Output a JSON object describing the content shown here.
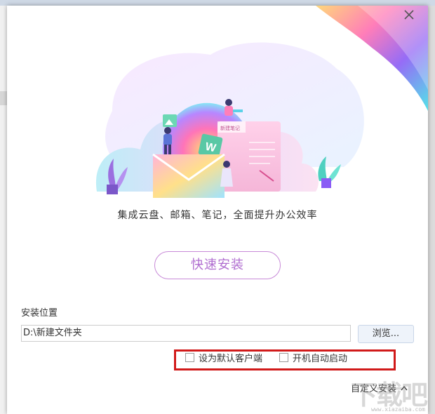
{
  "installer": {
    "tagline": "集成云盘、邮箱、笔记，全面提升办公效率",
    "install_button": "快速安装",
    "path_label": "安装位置",
    "path_value": "D:\\新建文件夹",
    "browse_button": "浏览...",
    "option_default_client": "设为默认客户端",
    "option_autostart": "开机自动启动",
    "custom_install": "自定义安装",
    "note_card_title": "新建笔记"
  },
  "icons": {
    "close": "close-icon",
    "chevron": "chevron-up-icon",
    "illustration": "office-suite-illustration"
  },
  "colors": {
    "accent": "#c88ad8",
    "accent_text": "#b06ed0",
    "highlight": "#d11a1a"
  },
  "watermark": {
    "text": "下载吧",
    "url": "www.xiazaiba.com"
  }
}
